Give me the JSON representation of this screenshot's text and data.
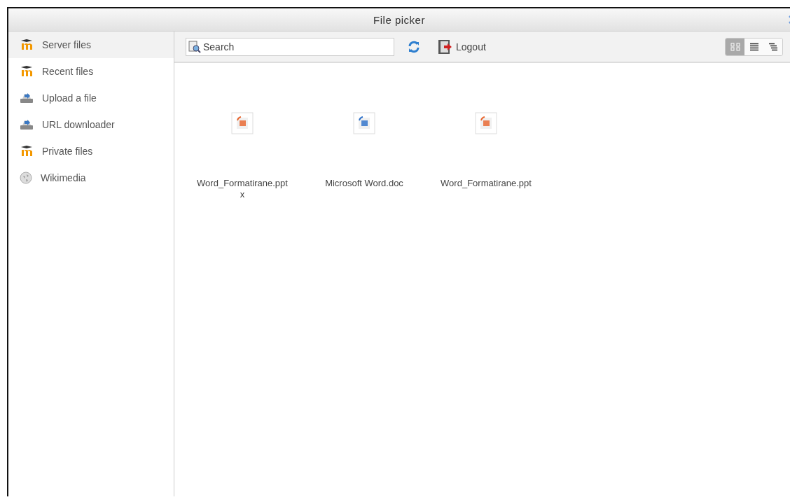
{
  "window": {
    "title": "File picker"
  },
  "sidebar": {
    "items": [
      {
        "label": "Server files",
        "kind": "moodle",
        "selected": true
      },
      {
        "label": "Recent files",
        "kind": "moodle",
        "selected": false
      },
      {
        "label": "Upload a file",
        "kind": "upload",
        "selected": false
      },
      {
        "label": "URL downloader",
        "kind": "upload",
        "selected": false
      },
      {
        "label": "Private files",
        "kind": "moodle",
        "selected": false
      },
      {
        "label": "Wikimedia",
        "kind": "wikimedia",
        "selected": false
      }
    ]
  },
  "toolbar": {
    "search": {
      "placeholder": "Search"
    },
    "logout": "Logout",
    "views": [
      {
        "kind": "icons",
        "selected": true
      },
      {
        "kind": "list",
        "selected": false
      },
      {
        "kind": "tree",
        "selected": false
      }
    ]
  },
  "files": [
    {
      "name": "Word_Formatirane.pptx",
      "kind": "ppt"
    },
    {
      "name": "Microsoft Word.doc",
      "kind": "doc"
    },
    {
      "name": "Word_Formatirane.ppt",
      "kind": "ppt"
    }
  ]
}
